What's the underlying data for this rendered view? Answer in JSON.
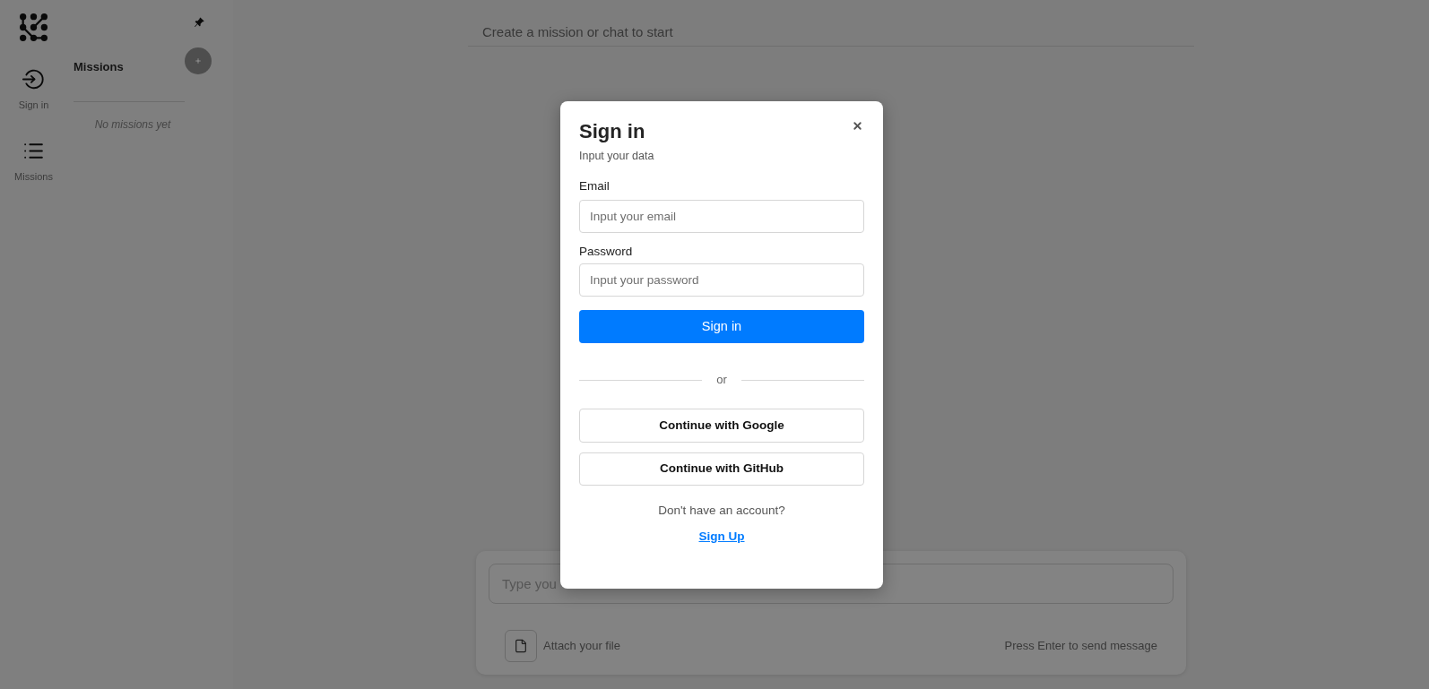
{
  "rail": {
    "items": [
      {
        "kind": "sign-in",
        "label": "Sign in"
      },
      {
        "kind": "list",
        "label": "Missions"
      }
    ]
  },
  "missions_panel": {
    "title": "Missions",
    "empty_text": "No missions yet"
  },
  "header": {
    "title": "Create a mission or chat to start"
  },
  "composer": {
    "placeholder": "Type you",
    "attach_label": "Attach your file",
    "hint": "Press Enter to send message"
  },
  "dialog": {
    "title": "Sign in",
    "subtitle": "Input your data",
    "fields": [
      {
        "label": "Email",
        "placeholder": "Input your email"
      },
      {
        "label": "Password",
        "placeholder": "Input your password"
      }
    ],
    "submit": "Sign in",
    "divider": "or",
    "providers": [
      "Continue with Google",
      "Continue with GitHub"
    ],
    "prompt": "Don't have an account?",
    "link": "Sign Up"
  }
}
